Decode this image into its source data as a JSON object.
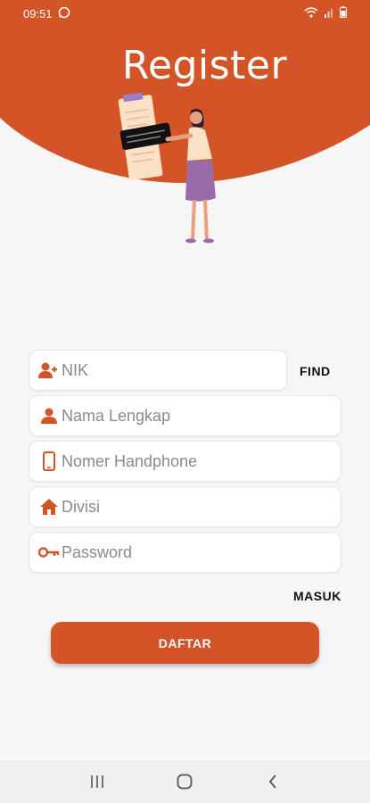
{
  "status_bar": {
    "time": "09:51",
    "icons": [
      "whatsapp-icon",
      "wifi-icon",
      "signal-icon",
      "battery-icon"
    ]
  },
  "header": {
    "title": "Register",
    "accent_color": "#d35527"
  },
  "form": {
    "nik": {
      "placeholder": "NIK",
      "icon": "add-user-icon"
    },
    "find_label": "FIND",
    "nama": {
      "placeholder": "Nama Lengkap",
      "icon": "person-icon"
    },
    "phone": {
      "placeholder": "Nomer Handphone",
      "icon": "phone-icon"
    },
    "divisi": {
      "placeholder": "Divisi",
      "icon": "home-icon"
    },
    "password": {
      "placeholder": "Password",
      "icon": "key-icon"
    }
  },
  "actions": {
    "masuk_label": "MASUK",
    "daftar_label": "DAFTAR"
  },
  "nav_bar": {
    "buttons": [
      "recents-icon",
      "home-button-icon",
      "back-icon"
    ]
  }
}
